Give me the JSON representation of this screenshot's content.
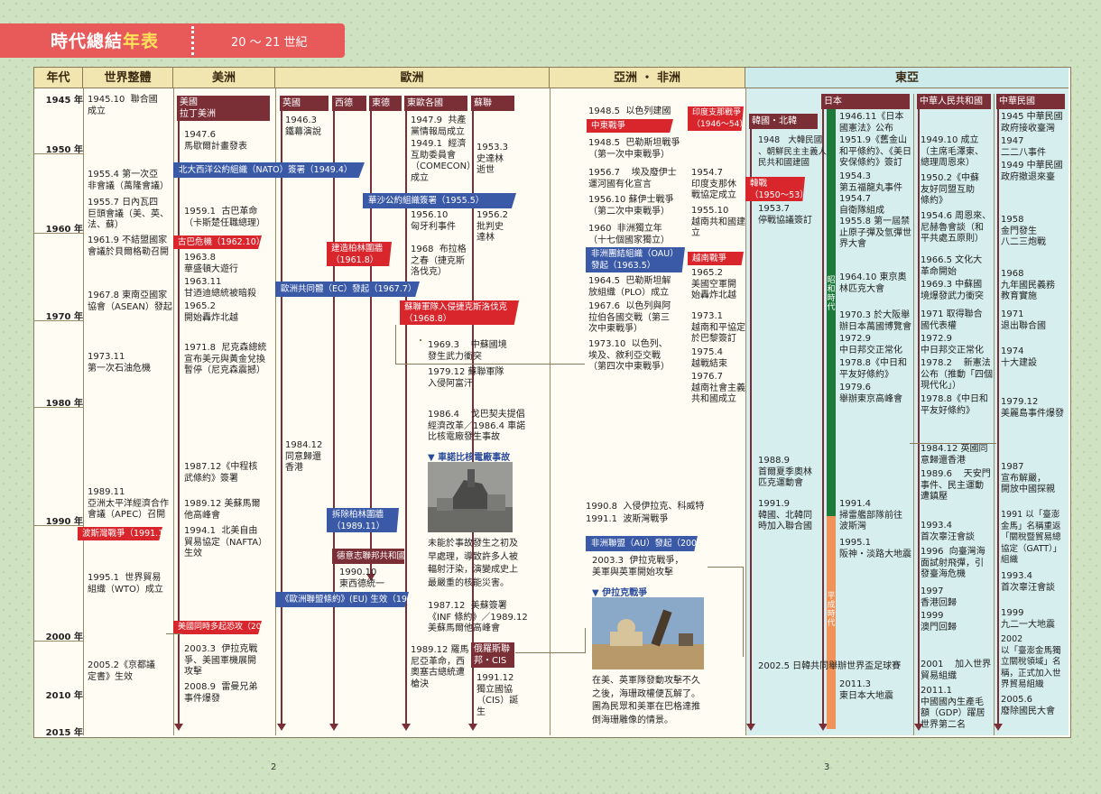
{
  "header": {
    "title_main": "時代總結",
    "title_accent": "年表",
    "subtitle": "20 ～ 21 世紀"
  },
  "columns": {
    "year": "年代",
    "world": "世界整體",
    "americas": "美洲",
    "europe": "歐洲",
    "asia_africa": "亞洲 ・ 非洲",
    "east_asia": "東亞"
  },
  "years": [
    "1945 年",
    "1950 年",
    "1960 年",
    "1970 年",
    "1980 年",
    "1990 年",
    "2000 年",
    "2010 年",
    "2015 年"
  ],
  "subheaders": {
    "americas": "美國\n拉丁美洲",
    "uk": "英國",
    "west_germany": "西德",
    "east_germany": "東德",
    "east_europe": "東歐各國",
    "soviet": "蘇聯",
    "korea": "韓國・北韓",
    "japan": "日本",
    "prc": "中華人民共和國",
    "roc": "中華民國",
    "russia_cis": "俄羅斯聯\n邦・CIS"
  },
  "world_events": {
    "e1": "1945.10  聯合國\n成立",
    "e2": "1955.4 第一次亞\n非會議（萬隆會議）",
    "e3": "1955.7 日內瓦四\n巨頭會議（美、英、\n法、蘇）",
    "e4": "1961.9 不結盟國家\n會議於貝爾格勒召開",
    "e5": "1967.8 東南亞國家\n協會（ASEAN）發起",
    "e6": "1973.11\n第一次石油危機",
    "e7": "1989.11\n亞洲太平洋經濟合作\n會議（APEC）召開",
    "e8": "1995.1  世界貿易\n組織（WTO）成立",
    "e9": "2005.2《京都議\n定書》生效"
  },
  "americas_events": {
    "e1": "1947.6\n馬歇爾計畫發表",
    "e2": "1959.1  古巴革命\n（卡斯楚任職總理）",
    "e3": "1963.8\n華盛頓大遊行",
    "e4": "1963.11\n甘迺迪總統被暗殺",
    "e5": "1965.2\n開始轟炸北越",
    "e6": "1971.8  尼克森總統\n宣布美元與黃金兌換\n暫停（尼克森震撼）",
    "e7": "1987.12《中程核\n武條約》簽署",
    "e8": "1989.12 美蘇馬爾\n他高峰會",
    "e9": "1994.1  北美自由\n貿易協定（NAFTA）\n生效",
    "e10": "2003.3  伊拉克戰\n爭、美國軍機展開\n攻擊",
    "e11": "2008.9  雷曼兄弟\n事件爆發"
  },
  "europe_events": {
    "uk1": "1946.3\n鐵幕演說",
    "uk2": "1984.12\n同意歸還\n香港",
    "ee1": "1947.9  共產\n黨情報局成立",
    "ee2": "1949.1  經濟\n互助委員會\n（COMECON）\n成立",
    "ee3": "1956.10\n匈牙利事件",
    "ee4": "1968  布拉格\n之春（捷克斯\n洛伐克）",
    "so1": "1953.3\n史達林\n逝世",
    "so2": "1956.2\n批判史\n達林",
    "ee5": "1969.3    中蘇國境\n發生武力衝突",
    "ee6": "1979.12 蘇聯軍隊\n入侵阿富汗",
    "ee7": "1986.4    戈巴契夫提倡\n經濟改革／1986.4 車諾\n比核電廠發生事故",
    "photo1_caption": "未能於事故發生之初及\n早處理，導致許多人被\n輻射汙染，演變成史上\n最嚴重的核能災害。",
    "ee8": "1987.12  美蘇簽署\n《INF 條約》／1989.12\n美蘇馬爾他高峰會",
    "ee9": "1989.12 羅馬\n尼亞革命，西\n奧塞古總統遭\n槍決",
    "ee10": "1990.10\n東西德統一",
    "ru1": "1991.12\n獨立國協\n（CIS）誕\n生"
  },
  "asia_events": {
    "a1": "1948.5  以色列建國",
    "a2": "1948.5  巴勒斯坦戰爭\n（第一次中東戰爭）",
    "a3": "1956.7    埃及廢伊士\n運河國有化宣言",
    "a4": "1956.10 蘇伊士戰爭\n（第二次中東戰爭）",
    "a5": "1960  非洲獨立年\n（十七個國家獨立）",
    "a6": "1964.5  巴勒斯坦解\n放組織（PLO）成立",
    "a7": "1967.6  以色列與阿\n拉伯各國交戰（第三\n次中東戰爭）",
    "a8": "1973.10  以色列、\n埃及、敘利亞交戰\n（第四次中東戰爭）",
    "a9": "1990.8  入侵伊拉克、科威特",
    "a10": "1991.1  波斯灣戰爭",
    "a11": "2003.3  伊拉克戰爭，\n美軍與英軍開始攻擊",
    "photo2_caption": "在美、英軍隊發動攻擊不久\n之後，海珊政權便瓦解了。\n圖為民眾和美軍在巴格達推\n倒海珊雕像的情景。",
    "v1": "1954.7\n印度支那休\n戰協定成立",
    "v2": "1955.10\n越南共和國建\n立",
    "v3": "1965.2\n美國空軍開\n始轟炸北越",
    "v4": "1973.1\n越南和平協定\n於巴黎簽訂",
    "v5": "1975.4\n越戰結束",
    "v6": "1976.7\n越南社會主義\n共和國成立"
  },
  "east_asia_events": {
    "k1": "1948   大韓民國\n、朝鮮民主主義人\n民共和國建國",
    "k2": "1953.7\n停戰協議簽訂",
    "k3": "1988.9\n首爾夏季奧林\n匹克運動會",
    "k4": "1991.9\n韓國、北韓同\n時加入聯合國",
    "k5": "2002.5 日韓共同舉辦世界盃足球賽",
    "j1": "1946.11《日本\n國憲法》公布",
    "j2": "1951.9《舊金山\n和平條約》、《美日\n安保條約》簽訂",
    "j3": "1954.3\n第五福龍丸事件",
    "j4": "1954.7\n自衛隊組成",
    "j5": "1955.8 第一屆禁\n止原子彈及氫彈世\n界大會",
    "j6": "1964.10 東京奧\n林匹克大會",
    "j7": "1970.3 於大阪舉\n辦日本萬國博覽會",
    "j8": "1972.9\n中日邦交正常化",
    "j9": "1978.8《中日和\n平友好條約》",
    "j10": "1979.6\n舉辦東京高峰會",
    "j11": "1991.4\n掃雷艦部隊前往\n波斯灣",
    "j12": "1995.1\n阪神・淡路大地震",
    "j13": "2011.3\n東日本大地震",
    "c1": "1949.10 成立\n（主席毛澤東、\n總理周恩來）",
    "c2": "1950.2《中蘇\n友好同盟互助\n條約》",
    "c3": "1954.6 周恩來、\n尼赫魯會談（和\n平共處五原則）",
    "c4": "1966.5 文化大\n革命開始",
    "c5": "1969.3 中蘇國\n境爆發武力衝突",
    "c6": "1971 取得聯合\n國代表權",
    "c7": "1972.9\n中日邦交正常化",
    "c8": "1978.2    新憲法\n公布（推動「四個\n現代化」）",
    "c9": "1978.8《中日和\n平友好條約》",
    "c10": "1984.12 英國同\n意歸還香港",
    "c11": "1989.6    天安門\n事件、民主運動\n遭鎮壓",
    "c12": "1993.4\n首次辜汪會談",
    "c13": "1996  向臺灣海\n面試射飛彈，引\n發臺海危機",
    "c14": "1997\n香港回歸",
    "c15": "1999\n澳門回歸",
    "c16": "2001    加入世界\n貿易組織",
    "c17": "2011.1\n中國國內生產毛\n額（GDP）躍居\n世界第二名",
    "r1": "1945 中華民國\n政府接收臺灣",
    "r2": "1947\n二二八事件",
    "r3": "1949 中華民國\n政府撤退來臺",
    "r4": "1958\n金門發生\n八二三炮戰",
    "r5": "1968\n九年國民義務\n教育實施",
    "r6": "1971\n退出聯合國",
    "r7": "1974\n十大建設",
    "r8": "1979.12\n美麗島事件爆發",
    "r9": "1987\n宣布解嚴，\n開放中國探親",
    "r10": "1991 以「臺澎\n金馬」名稱重返\n「關稅暨貿易總\n協定（GATT）」\n組織",
    "r11": "1993.4\n首次辜汪會談",
    "r12": "1999\n九二一大地震",
    "r13": "2002\n以「臺澎金馬獨\n立關稅領域」名\n稱，正式加入世\n界貿易組織",
    "r14": "2005.6\n廢除國民大會"
  },
  "tags": {
    "nato": "北大西洋公約組織（NATO）簽署（1949.4）",
    "warsaw": "華沙公約組織簽署（1955.5）",
    "cuba": "古巴危機（1962.10）",
    "berlin_wall_build": "建造柏林圍牆\n（1961.8）",
    "ec": "歐洲共同體（EC）發起（1967.7）",
    "prague": "蘇聯軍隊入侵捷克斯洛伐克\n（1968.8）",
    "middle_east": "中東戰爭",
    "indochina": "印度支那戰爭\n（1946～54）",
    "korean_war": "韓戰\n（1950～53）",
    "oau": "非洲團結組織（OAU）\n發起（1963.5）",
    "vietnam_war": "越南戰爭",
    "berlin_wall_fall": "拆除柏林圍牆\n（1989.11）",
    "gulf_war": "波斯灣戰爭（1991.1）",
    "german_fed": "德意志聯邦共和國",
    "eu": "《歐洲聯盟條約》(EU) 生效（1993.10）",
    "au": "非洲聯盟（AU）發起（2002.7）",
    "sept11": "美國同時多起恐攻（2001.9）"
  },
  "photos": {
    "chernobyl_title": "▼ 車諾比核電廠事故",
    "iraq_title": "▼ 伊拉克戰爭"
  },
  "eras": {
    "showa": "昭和時代",
    "heisei": "平成時代"
  },
  "pages": {
    "left": "2",
    "right": "3"
  },
  "colors": {
    "header_red": "#e85a5a",
    "title_accent": "#ffe35a",
    "wine": "#7a2e36",
    "tag_red": "#d8262c",
    "tag_blue": "#3a5aa8",
    "east_asia_bg": "#cdebeb",
    "showa_green": "#1e7a3a",
    "heisei_orange": "#f0935a"
  }
}
